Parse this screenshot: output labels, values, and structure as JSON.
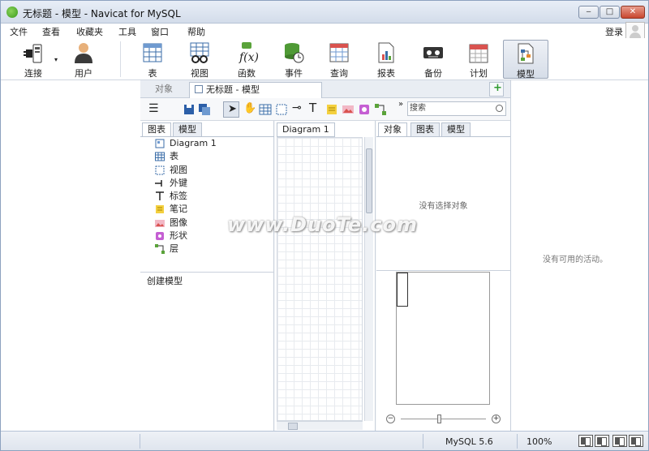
{
  "window": {
    "title": "无标题 - 模型 - Navicat for MySQL",
    "minimize": "‒",
    "maximize": "□",
    "close": "✕"
  },
  "menu": [
    "文件",
    "查看",
    "收藏夹",
    "工具",
    "窗口",
    "帮助"
  ],
  "account": {
    "login": "登录"
  },
  "toolbar": [
    {
      "label": "连接",
      "icon": "plug-icon"
    },
    {
      "label": "用户",
      "icon": "user-icon"
    },
    {
      "label": "表",
      "icon": "table-icon"
    },
    {
      "label": "视图",
      "icon": "view-icon"
    },
    {
      "label": "函数",
      "icon": "function-icon"
    },
    {
      "label": "事件",
      "icon": "event-icon"
    },
    {
      "label": "查询",
      "icon": "query-icon"
    },
    {
      "label": "报表",
      "icon": "report-icon"
    },
    {
      "label": "备份",
      "icon": "backup-icon"
    },
    {
      "label": "计划",
      "icon": "calendar-icon"
    },
    {
      "label": "模型",
      "icon": "model-icon",
      "active": true
    }
  ],
  "tabs": {
    "object": "对象",
    "model": "无标题 - 模型"
  },
  "search": {
    "placeholder": "搜索"
  },
  "left_panel": {
    "tabs": [
      "图表",
      "模型"
    ],
    "items": [
      "Diagram 1",
      "表",
      "视图",
      "外键",
      "标签",
      "笔记",
      "图像",
      "形状",
      "层"
    ],
    "create": "创建模型"
  },
  "diagram": {
    "tab": "Diagram 1"
  },
  "right_panel": {
    "tabs": [
      "对象",
      "图表",
      "模型"
    ],
    "no_selection": "没有选择对象"
  },
  "activity": {
    "empty": "没有可用的活动。"
  },
  "status": {
    "server": "MySQL 5.6",
    "zoom": "100%"
  },
  "watermark": "www.DuoTe.com",
  "colors": {
    "accent": "#3a7bd5",
    "model_active": "#d6dde8"
  }
}
